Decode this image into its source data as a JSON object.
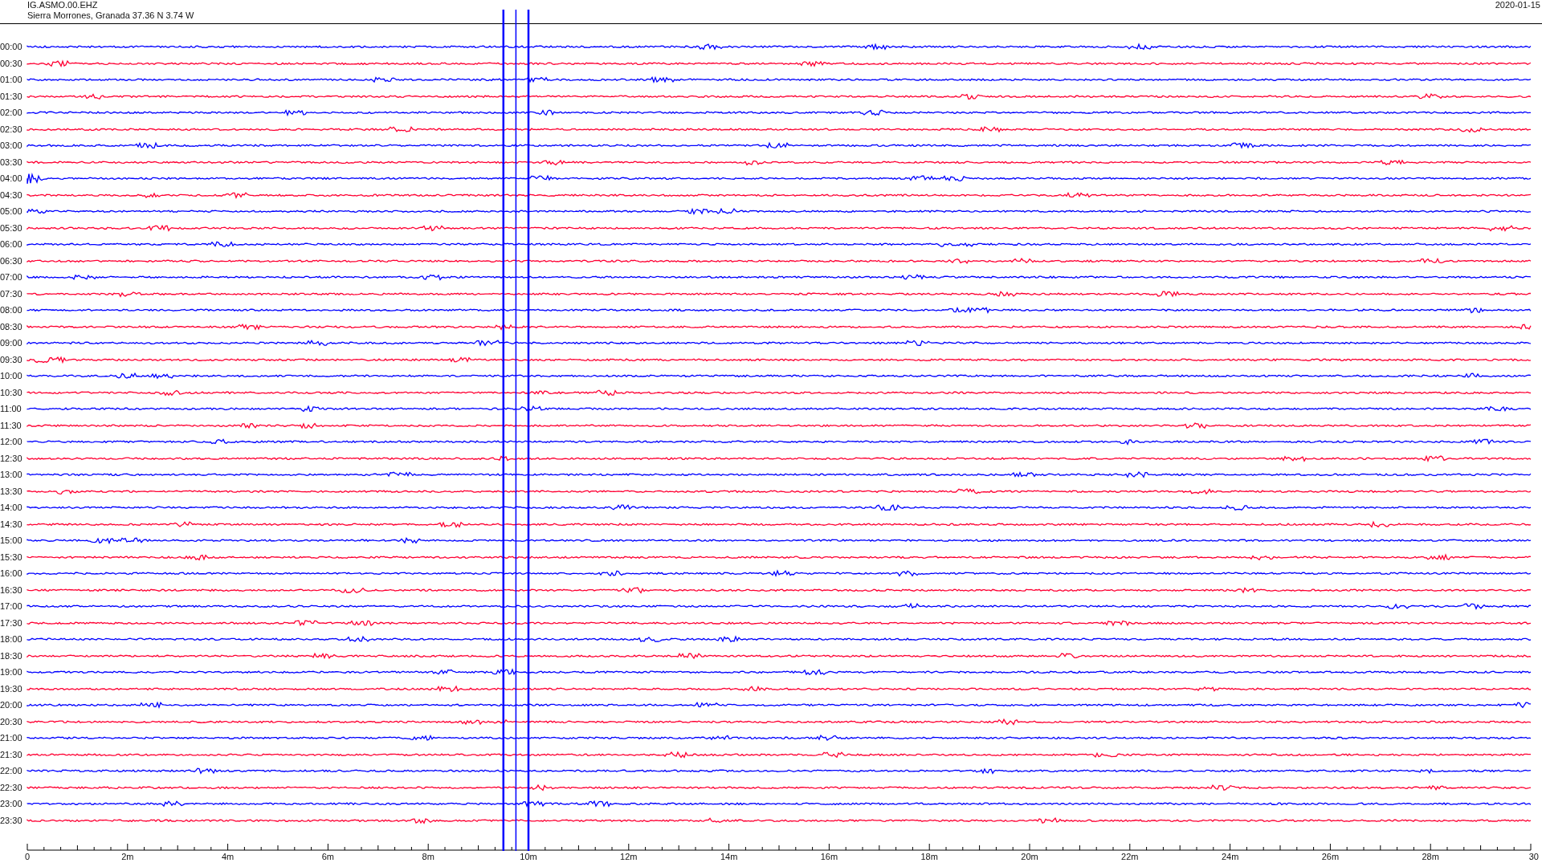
{
  "header": {
    "station": "IG.ASMO.00.EHZ",
    "location": "Sierra Morrones, Granada  37.36 N 3.74 W",
    "date": "2020-01-15"
  },
  "rows": [
    {
      "label": "00:00",
      "color": "#0000ff"
    },
    {
      "label": "00:30",
      "color": "#ff0033"
    },
    {
      "label": "01:00",
      "color": "#0000ff"
    },
    {
      "label": "01:30",
      "color": "#ff0033"
    },
    {
      "label": "02:00",
      "color": "#0000ff"
    },
    {
      "label": "02:30",
      "color": "#ff0033"
    },
    {
      "label": "03:00",
      "color": "#0000ff"
    },
    {
      "label": "03:30",
      "color": "#ff0033"
    },
    {
      "label": "04:00",
      "color": "#0000ff"
    },
    {
      "label": "04:30",
      "color": "#ff0033"
    },
    {
      "label": "05:00",
      "color": "#0000ff"
    },
    {
      "label": "05:30",
      "color": "#ff0033"
    },
    {
      "label": "06:00",
      "color": "#0000ff"
    },
    {
      "label": "06:30",
      "color": "#ff0033"
    },
    {
      "label": "07:00",
      "color": "#0000ff"
    },
    {
      "label": "07:30",
      "color": "#ff0033"
    },
    {
      "label": "08:00",
      "color": "#0000ff"
    },
    {
      "label": "08:30",
      "color": "#ff0033"
    },
    {
      "label": "09:00",
      "color": "#0000ff"
    },
    {
      "label": "09:30",
      "color": "#ff0033"
    },
    {
      "label": "10:00",
      "color": "#0000ff"
    },
    {
      "label": "10:30",
      "color": "#ff0033"
    },
    {
      "label": "11:00",
      "color": "#0000ff"
    },
    {
      "label": "11:30",
      "color": "#ff0033"
    },
    {
      "label": "12:00",
      "color": "#0000ff"
    },
    {
      "label": "12:30",
      "color": "#ff0033"
    },
    {
      "label": "13:00",
      "color": "#0000ff"
    },
    {
      "label": "13:30",
      "color": "#ff0033"
    },
    {
      "label": "14:00",
      "color": "#0000ff"
    },
    {
      "label": "14:30",
      "color": "#ff0033"
    },
    {
      "label": "15:00",
      "color": "#0000ff"
    },
    {
      "label": "15:30",
      "color": "#ff0033"
    },
    {
      "label": "16:00",
      "color": "#0000ff"
    },
    {
      "label": "16:30",
      "color": "#ff0033"
    },
    {
      "label": "17:00",
      "color": "#0000ff"
    },
    {
      "label": "17:30",
      "color": "#ff0033"
    },
    {
      "label": "18:00",
      "color": "#0000ff"
    },
    {
      "label": "18:30",
      "color": "#ff0033"
    },
    {
      "label": "19:00",
      "color": "#0000ff"
    },
    {
      "label": "19:30",
      "color": "#ff0033"
    },
    {
      "label": "20:00",
      "color": "#0000ff"
    },
    {
      "label": "20:30",
      "color": "#ff0033"
    },
    {
      "label": "21:00",
      "color": "#0000ff"
    },
    {
      "label": "21:30",
      "color": "#ff0033"
    },
    {
      "label": "22:00",
      "color": "#0000ff"
    },
    {
      "label": "22:30",
      "color": "#ff0033"
    },
    {
      "label": "23:00",
      "color": "#0000ff"
    },
    {
      "label": "23:30",
      "color": "#ff0033"
    }
  ],
  "x_axis": {
    "ticks": [
      "0",
      "2m",
      "4m",
      "6m",
      "8m",
      "10m",
      "12m",
      "14m",
      "16m",
      "18m",
      "20m",
      "22m",
      "24m",
      "26m",
      "28m",
      "30"
    ]
  }
}
